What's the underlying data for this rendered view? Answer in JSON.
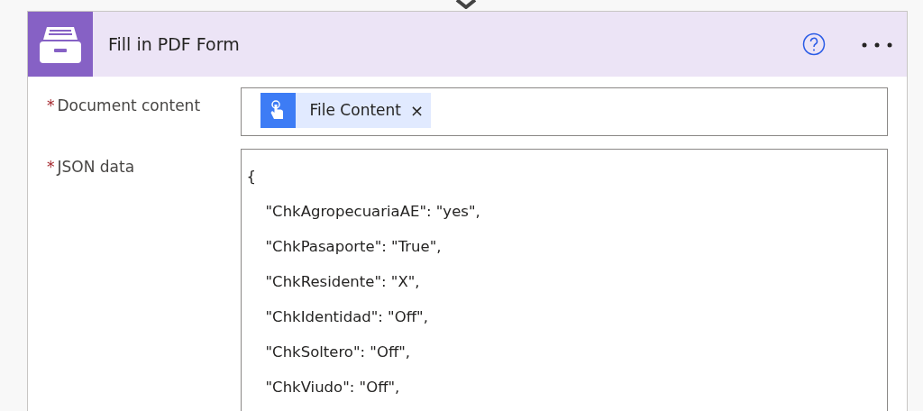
{
  "action": {
    "title": "Fill in PDF Form"
  },
  "fields": [
    {
      "kind": "token",
      "label": "Document content",
      "required_mark": "*",
      "token": {
        "label": "File Content",
        "remove": "×"
      }
    },
    {
      "kind": "text",
      "label": "JSON data",
      "required_mark": "*",
      "lines": [
        "{",
        "\"ChkAgropecuariaAE\": \"yes\",",
        "\"ChkPasaporte\": \"True\",",
        "\"ChkResidente\": \"X\",",
        "\"ChkIdentidad\": \"Off\",",
        "\"ChkSoltero\": \"Off\",",
        "\"ChkViudo\": \"Off\","
      ]
    }
  ]
}
